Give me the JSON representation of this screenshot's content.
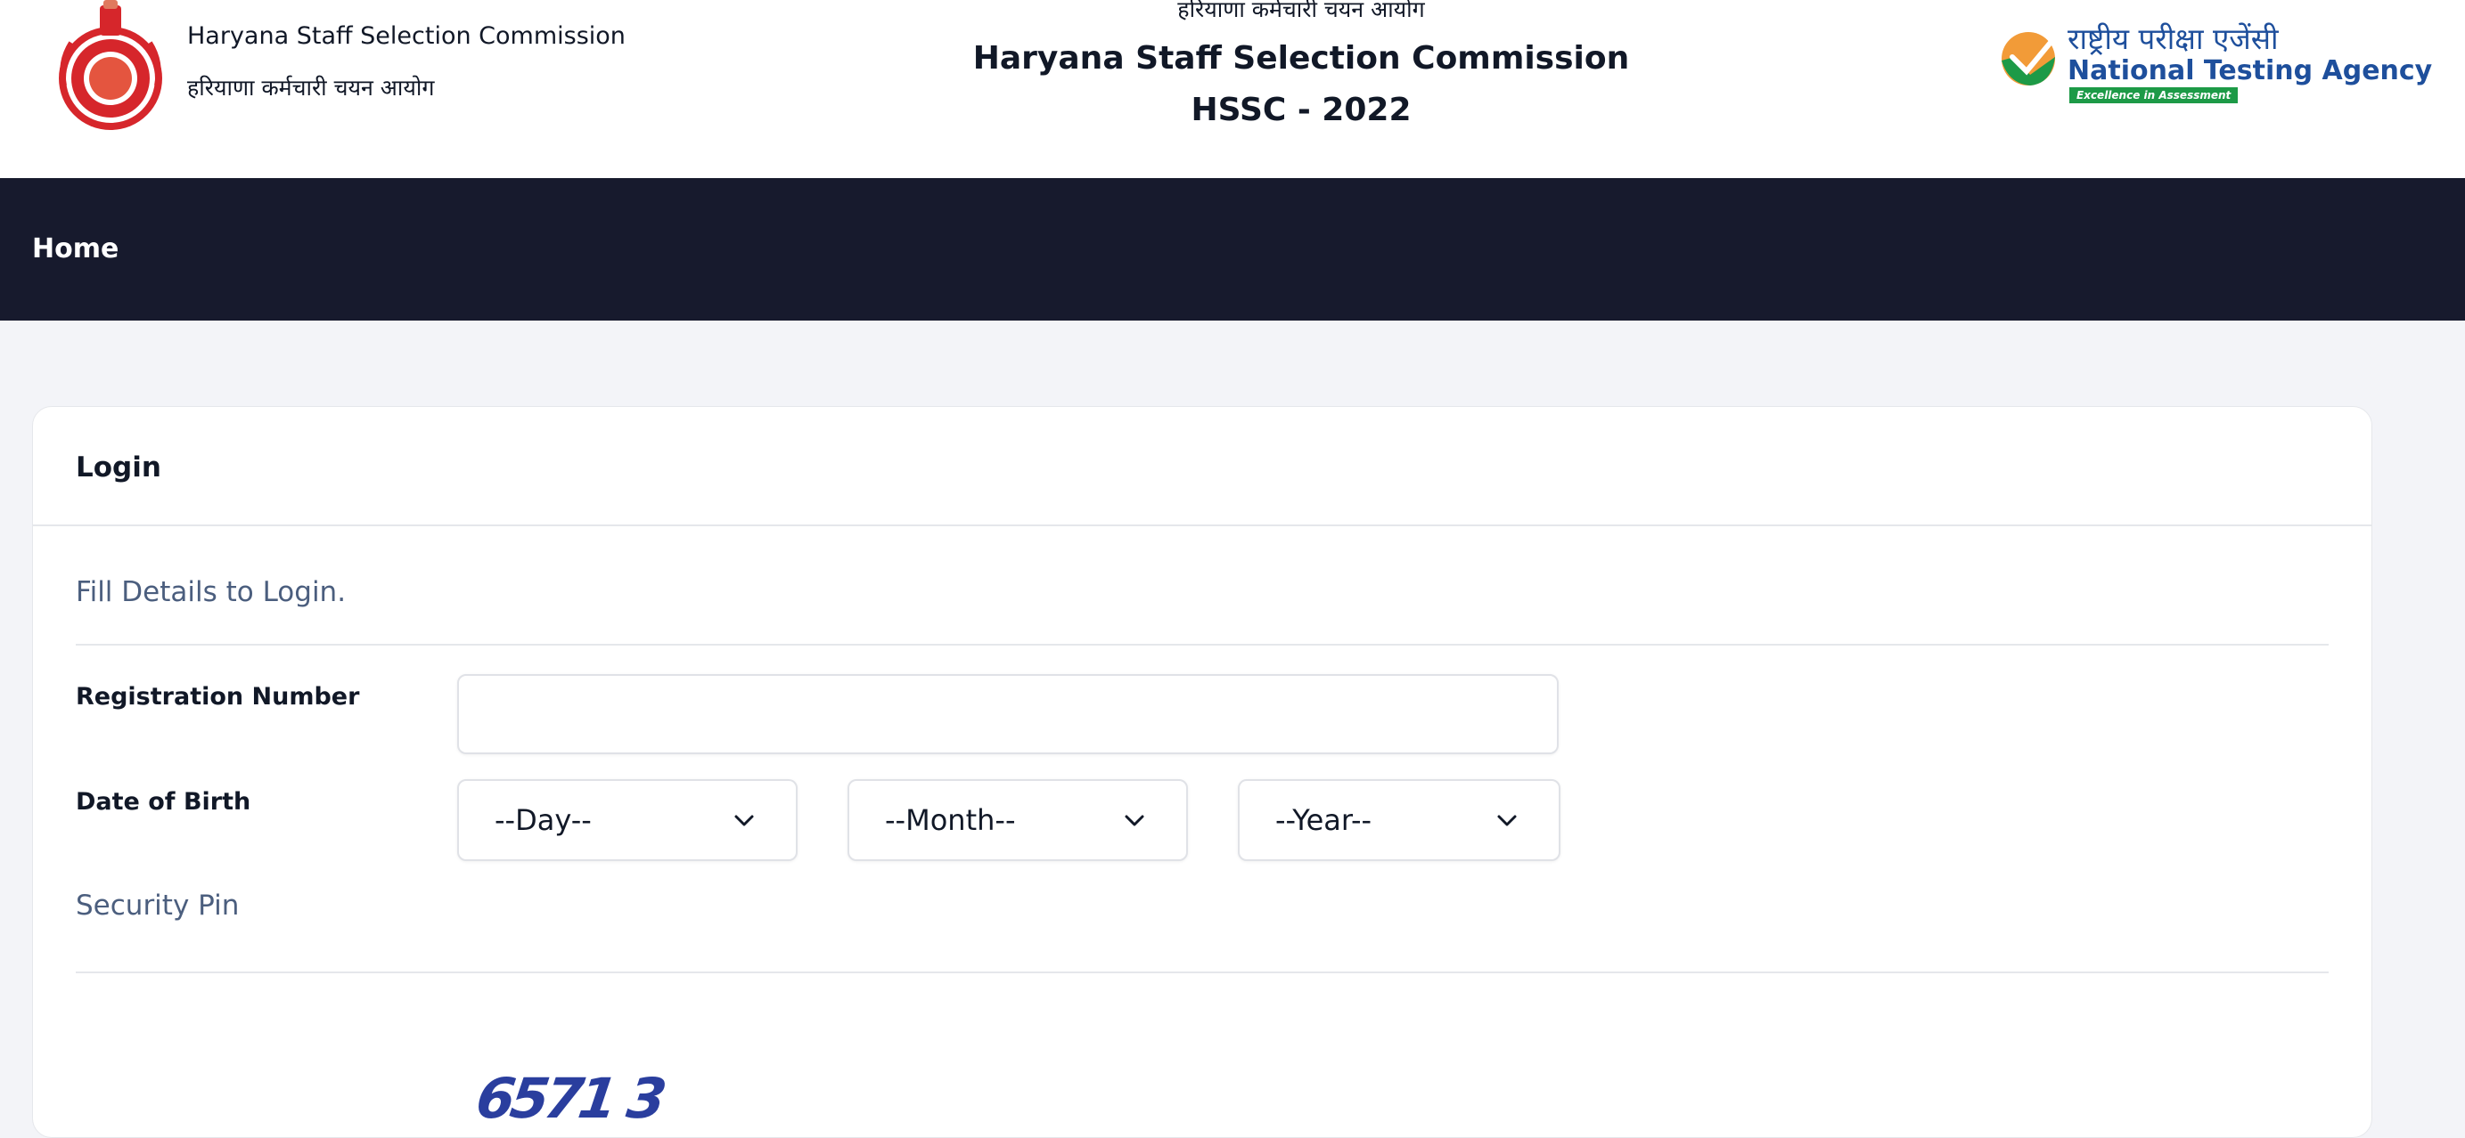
{
  "header": {
    "org_name_en": "Haryana Staff Selection Commission",
    "org_name_hi": "हरियाणा कर्मचारी चयन आयोग",
    "center_hi": "हरियाणा कर्मचारी चयन आयोग",
    "center_title": "Haryana Staff Selection Commission",
    "center_subtitle": "HSSC - 2022",
    "nta_hi": "राष्ट्रीय परीक्षा एजेंसी",
    "nta_en": "National Testing Agency",
    "nta_tagline": "Excellence in Assessment"
  },
  "nav": {
    "home_label": "Home"
  },
  "login": {
    "title": "Login",
    "subtitle": "Fill Details to Login.",
    "registration_label": "Registration Number",
    "registration_value": "",
    "dob_label": "Date of Birth",
    "day_value": "--Day--",
    "month_value": "--Month--",
    "year_value": "--Year--",
    "security_pin_label": "Security Pin",
    "captcha_text": "6571 3"
  },
  "colors": {
    "nav_bg": "#171a2d",
    "page_bg": "#f3f4f8",
    "muted_text": "#4b5e7e",
    "captcha": "#2a3e9e",
    "nta_blue": "#1e4f9c",
    "nta_green": "#1d9a47",
    "emblem_red": "#d6262b"
  },
  "icons": {
    "emblem": "haryana-emblem-icon",
    "nta_logo": "nta-check-icon",
    "select_chevron": "chevron-down-icon"
  }
}
